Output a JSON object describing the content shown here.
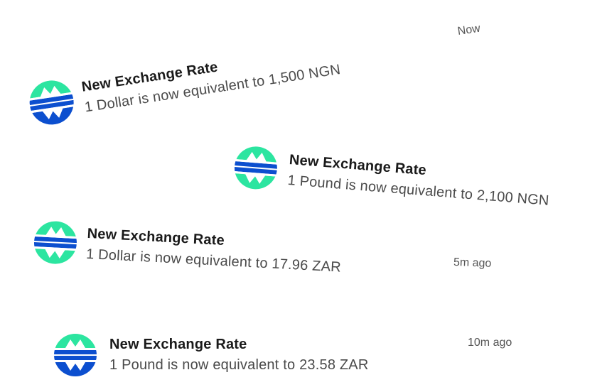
{
  "colors": {
    "logo_green": "#2ce5a0",
    "logo_blue": "#0c4fcf",
    "title": "#1a1a1a",
    "message": "#4a4a4a",
    "time": "#555555"
  },
  "notifications": [
    {
      "icon": "exchange-logo-icon",
      "title": "New Exchange Rate",
      "message": "1 Dollar is now equivalent to 1,500 NGN",
      "time": "Now"
    },
    {
      "icon": "exchange-logo-icon",
      "title": "New Exchange Rate",
      "message": "1 Pound is now equivalent to 2,100 NGN",
      "time": ""
    },
    {
      "icon": "exchange-logo-icon",
      "title": "New Exchange Rate",
      "message": "1 Dollar is now equivalent to 17.96 ZAR",
      "time": "5m ago"
    },
    {
      "icon": "exchange-logo-icon",
      "title": "New Exchange Rate",
      "message": "1 Pound is now equivalent to 23.58 ZAR",
      "time": "10m ago"
    }
  ]
}
